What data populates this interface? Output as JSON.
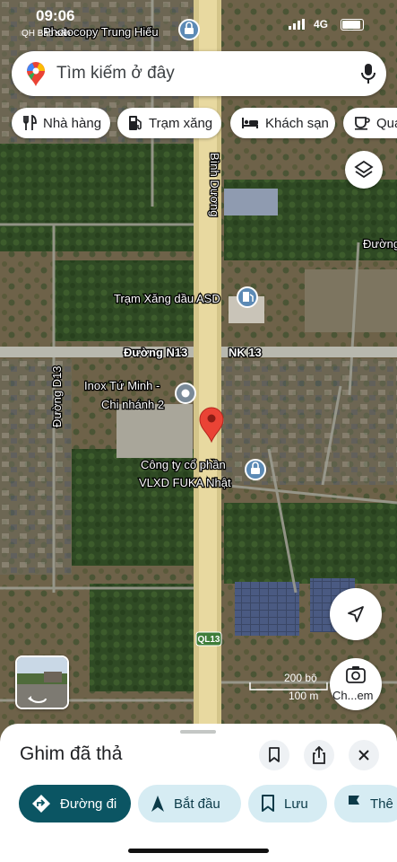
{
  "status_bar": {
    "time": "09:06",
    "network": "4G",
    "carrier": "QH Bảo sắn"
  },
  "search": {
    "placeholder": "Tìm kiếm ở đây",
    "pin_icon": "google-maps-pin-icon",
    "mic_icon": "mic-icon"
  },
  "chips": [
    {
      "label": "Nhà hàng",
      "icon": "restaurant-icon"
    },
    {
      "label": "Trạm xăng",
      "icon": "gas-station-icon"
    },
    {
      "label": "Khách sạn",
      "icon": "hotel-icon"
    },
    {
      "label": "Quá",
      "icon": "cafe-icon"
    }
  ],
  "map": {
    "labels": {
      "photocopy": "Photocopy Trung Hiếu",
      "binh_duong": "Bình Dương",
      "duong_top_right": "Đường",
      "gas": "Trạm Xăng dầu ASD",
      "n13": "Đường N13",
      "nk13": "NK 13",
      "inox_line1": "Inox Tứ Minh -",
      "inox_line2": "Chi nhánh 2",
      "fuka_line1": "Công ty cổ phần",
      "fuka_line2": "VLXD FUKA Nhật",
      "d13": "Đường D13",
      "ql13": "QL13"
    },
    "scale_ft": "200 bộ",
    "scale_m": "100 m",
    "lens_label": "Ch...em",
    "colors": {
      "road": "#e8d9a0",
      "pin": "#ea4335",
      "poi": "#6b8fb0"
    }
  },
  "sheet": {
    "title": "Ghim đã thả",
    "actions": [
      {
        "label": "Đường đi",
        "icon": "directions-icon"
      },
      {
        "label": "Bắt đầu",
        "icon": "navigation-arrow-icon"
      },
      {
        "label": "Lưu",
        "icon": "bookmark-icon"
      },
      {
        "label": "Thê",
        "icon": "flag-icon"
      }
    ]
  }
}
